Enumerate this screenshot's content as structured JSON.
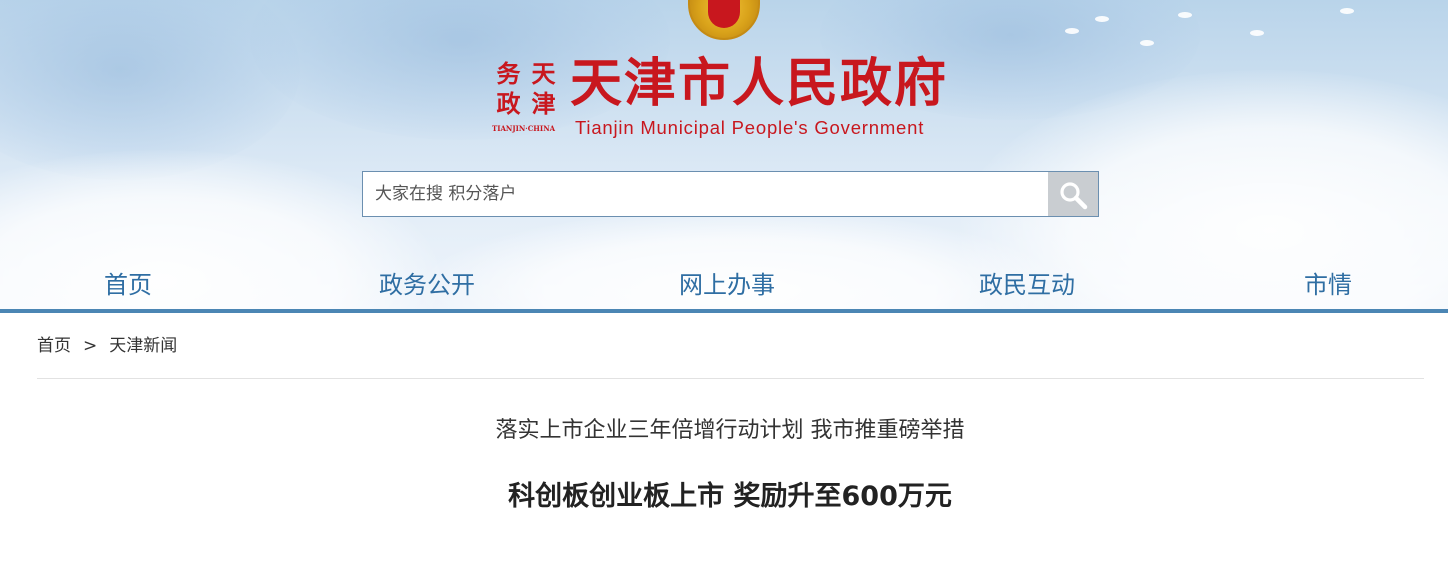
{
  "header": {
    "logo_seal_chars": [
      "天",
      "津",
      "政",
      "务"
    ],
    "logo_seal_subtext": "TIANJIN·CHINA",
    "site_title": "天津市人民政府",
    "site_subtitle": "Tianjin Municipal People's Government"
  },
  "search": {
    "placeholder": "大家在搜 积分落户",
    "button_icon": "search-icon"
  },
  "nav": {
    "items": [
      {
        "label": "首页"
      },
      {
        "label": "政务公开"
      },
      {
        "label": "网上办事"
      },
      {
        "label": "政民互动"
      },
      {
        "label": "市情"
      }
    ]
  },
  "breadcrumb": {
    "items": [
      {
        "label": "首页"
      },
      {
        "label": "天津新闻"
      }
    ],
    "separator": ">"
  },
  "article": {
    "pre_title": "落实上市企业三年倍增行动计划 我市推重磅举措",
    "title": "科创板创业板上市 奖励升至600万元"
  },
  "colors": {
    "brand_red": "#c8171e",
    "nav_blue": "#2f6ea3",
    "nav_bar": "#4b86b4"
  }
}
